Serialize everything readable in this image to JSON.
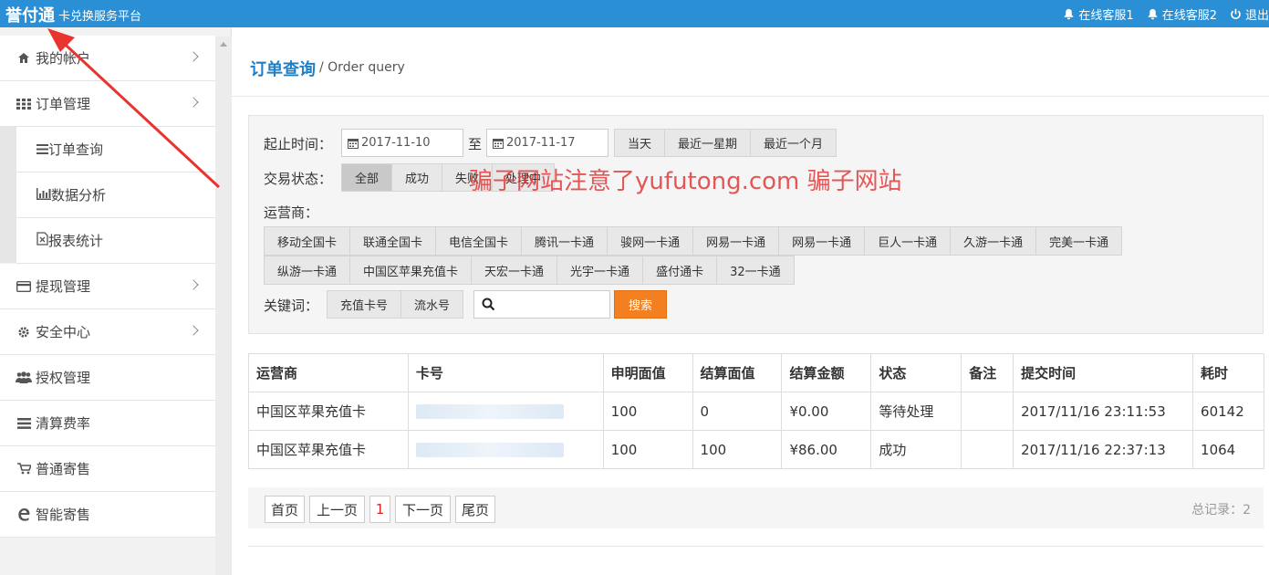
{
  "topbar": {
    "logo": "誉付通",
    "subtitle": "卡兑换服务平台",
    "links": [
      {
        "label": "在线客服1",
        "icon": "bell-icon"
      },
      {
        "label": "在线客服2",
        "icon": "bell-icon"
      },
      {
        "label": "退出",
        "icon": "power-icon"
      }
    ]
  },
  "sidebar": {
    "items": [
      {
        "label": "我的帐户",
        "icon": "home-icon"
      },
      {
        "label": "订单管理",
        "icon": "grid-icon"
      },
      {
        "label": "订单查询",
        "icon": "list-icon"
      },
      {
        "label": "数据分析",
        "icon": "bar-chart-icon"
      },
      {
        "label": "报表统计",
        "icon": "file-excel-icon"
      },
      {
        "label": "提现管理",
        "icon": "credit-card-icon"
      },
      {
        "label": "安全中心",
        "icon": "gear-icon"
      },
      {
        "label": "授权管理",
        "icon": "users-icon"
      },
      {
        "label": "清算费率",
        "icon": "bars-icon"
      },
      {
        "label": "普通寄售",
        "icon": "cart-icon"
      },
      {
        "label": "智能寄售",
        "icon": "edge-icon"
      }
    ]
  },
  "page": {
    "title": "订单查询",
    "subtitle": "/ Order query"
  },
  "filter": {
    "date_label": "起止时间：",
    "start_date": "2017-11-10",
    "to": "至",
    "end_date": "2017-11-17",
    "ranges": [
      "当天",
      "最近一星期",
      "最近一个月"
    ],
    "status_label": "交易状态：",
    "statuses": [
      "全部",
      "成功",
      "失败",
      "处理中"
    ],
    "status_active": "全部",
    "operator_label": "运营商：",
    "operators_row1": [
      "移动全国卡",
      "联通全国卡",
      "电信全国卡",
      "腾讯一卡通",
      "骏网一卡通",
      "网易一卡通",
      "网易一卡通",
      "巨人一卡通",
      "久游一卡通",
      "完美一卡通"
    ],
    "operators_row2": [
      "纵游一卡通",
      "中国区苹果充值卡",
      "天宏一卡通",
      "光宇一卡通",
      "盛付通卡",
      "32一卡通"
    ],
    "keyword_label": "关键词：",
    "keyword_types": [
      "充值卡号",
      "流水号"
    ],
    "search_value": "",
    "search_button": "搜索"
  },
  "watermark": "骗子网站注意了yufutong.com 骗子网站",
  "table": {
    "headers": [
      "运营商",
      "卡号",
      "申明面值",
      "结算面值",
      "结算金额",
      "状态",
      "备注",
      "提交时间",
      "耗时"
    ],
    "rows": [
      {
        "operator": "中国区苹果充值卡",
        "card": "",
        "declared": "100",
        "settled_face": "0",
        "amount": "¥0.00",
        "status": "等待处理",
        "note": "",
        "time": "2017/11/16 23:11:53",
        "cost": "60142"
      },
      {
        "operator": "中国区苹果充值卡",
        "card": "",
        "declared": "100",
        "settled_face": "100",
        "amount": "¥86.00",
        "status": "成功",
        "note": "",
        "time": "2017/11/16 22:37:13",
        "cost": "1064"
      }
    ]
  },
  "pager": {
    "first": "首页",
    "prev": "上一页",
    "current": "1",
    "next": "下一页",
    "last": "尾页",
    "total": "总记录：2"
  },
  "colors": {
    "topbar": "#2a8fd4",
    "title": "#1f7fc5",
    "search": "#f38020",
    "money": "#5aa84c",
    "cost": "#e07a2c",
    "annotation": "#e8332f"
  }
}
